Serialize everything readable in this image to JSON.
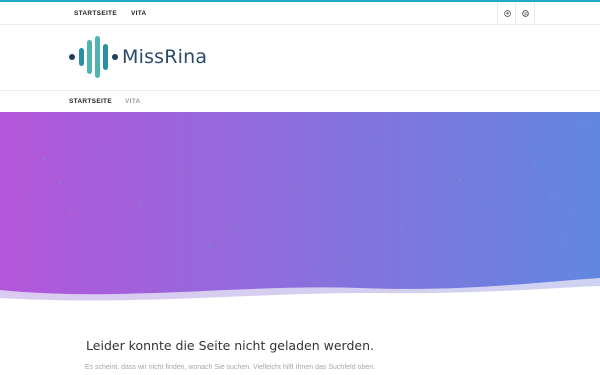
{
  "topnav": {
    "items": [
      {
        "label": "STARTSEITE",
        "active": true
      },
      {
        "label": "VITA",
        "active": false
      }
    ],
    "social_icons": [
      "github-icon",
      "dribbble-icon"
    ]
  },
  "logo": {
    "text": "MissRina",
    "mark_colors": [
      "#1f3d5c",
      "#4fb3b0",
      "#2a8fa8"
    ]
  },
  "mainnav": {
    "items": [
      {
        "label": "STARTSEITE",
        "active": true
      },
      {
        "label": "VITA",
        "active": false
      }
    ]
  },
  "hero": {
    "gradient_start": "#b456d9",
    "gradient_end": "#6287e0"
  },
  "error": {
    "title": "Leider konnte die Seite nicht geladen werden.",
    "text": "Es scheint, dass wir nicht finden, wonach Sie suchen. Vielleicht hilft Ihnen das Suchfeld oben."
  },
  "colors": {
    "accent": "#1ea8c7",
    "text_dark": "#222222",
    "text_muted": "#a6a6a6"
  }
}
